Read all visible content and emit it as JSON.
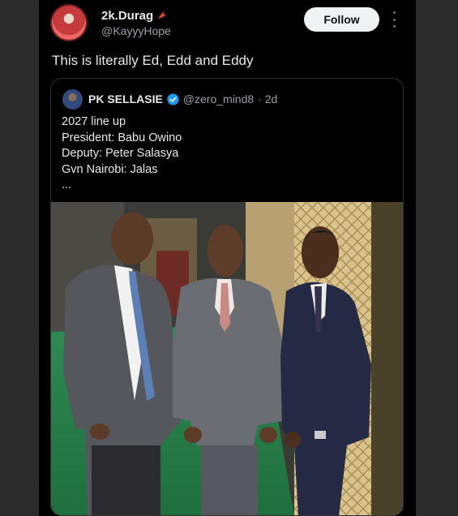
{
  "post": {
    "display_name": "2k.Durag",
    "handle": "@KayyyHope",
    "follow_label": "Follow",
    "text": "This is literally Ed, Edd and Eddy"
  },
  "quoted_post": {
    "display_name": "PK SELLASIE",
    "handle": "@zero_mind8",
    "time": "· 2d",
    "lines": [
      "2027 line up",
      "President: Babu Owino",
      "Deputy: Peter Salasya",
      "Gvn Nairobi: Jalas",
      "..."
    ]
  },
  "colors": {
    "background": "#000000",
    "text": "#e7e9ea",
    "muted": "#9aa0a6",
    "verified": "#1d9bf0",
    "follow_bg": "#eff3f4"
  }
}
